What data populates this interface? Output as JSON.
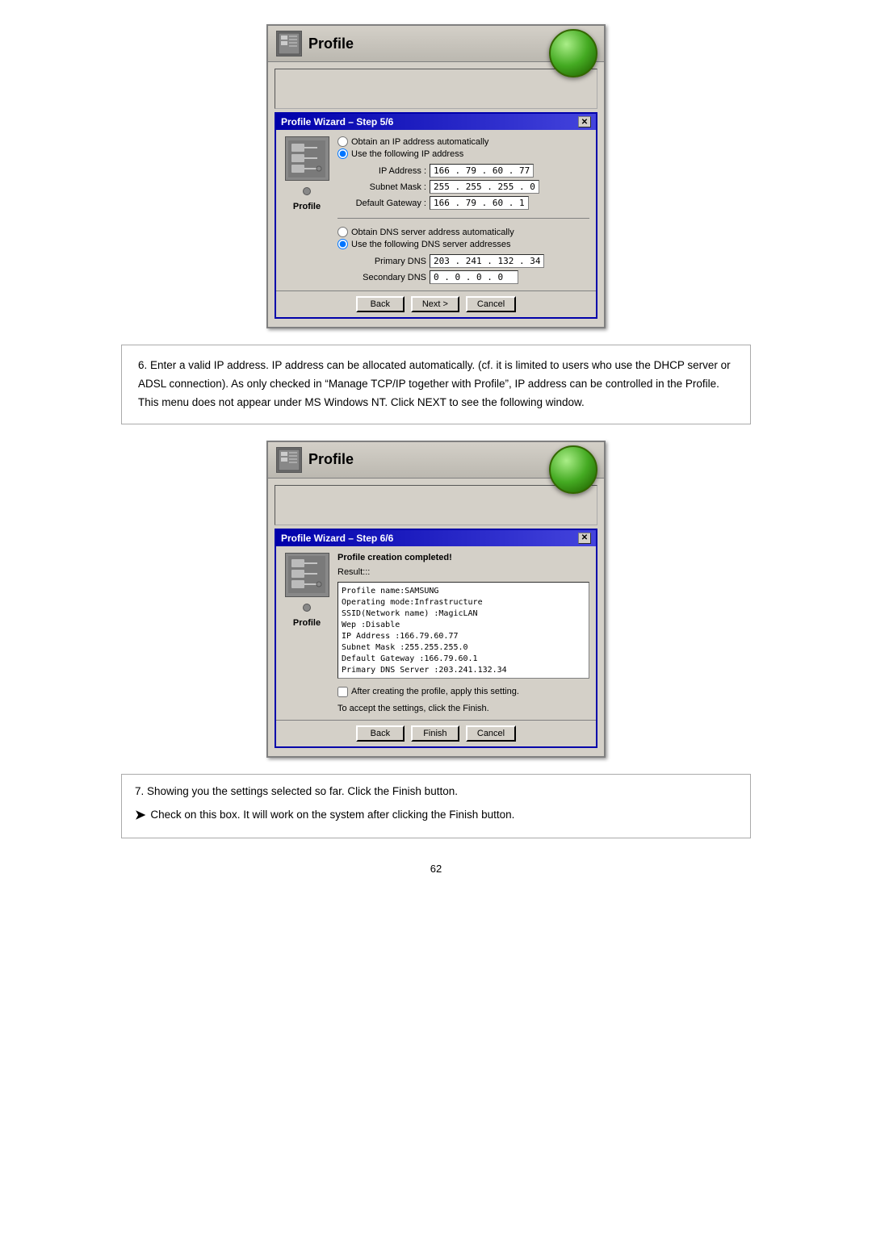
{
  "page": {
    "number": "62"
  },
  "window1": {
    "title": "Profile",
    "wizard_title": "Profile Wizard – Step 5/6",
    "close_btn": "✕",
    "radio1": "Obtain an IP address automatically",
    "radio2": "Use the following IP address",
    "ip_label": "IP Address :",
    "ip_value": "166 . 79 . 60 . 77",
    "subnet_label": "Subnet Mask :",
    "subnet_value": "255 . 255 . 255 . 0",
    "gateway_label": "Default Gateway :",
    "gateway_value": "166 . 79 . 60 . 1",
    "dns_radio1": "Obtain DNS server address automatically",
    "dns_radio2": "Use the following DNS server addresses",
    "primary_label": "Primary DNS",
    "primary_value": "203 . 241 . 132 . 34",
    "secondary_label": "Secondary DNS",
    "secondary_value": "0 . 0 . 0 . 0",
    "back_btn": "Back",
    "next_btn": "Next >",
    "cancel_btn": "Cancel",
    "profile_label": "Profile"
  },
  "info1": {
    "text": "6. Enter a valid IP address. IP address can be allocated automatically. (cf. it is limited to users who use the DHCP server or ADSL connection). As only checked in “Manage TCP/IP together with Profile”, IP address can be controlled in the Profile. This menu does not appear under MS Windows NT. Click NEXT to see the following window."
  },
  "window2": {
    "title": "Profile",
    "wizard_title": "Profile Wizard – Step 6/6",
    "close_btn": "✕",
    "completed_text": "Profile creation completed!",
    "result_label": "Result:::",
    "result_lines": [
      "Profile name:SAMSUNG",
      "Operating mode:Infrastructure",
      "SSID(Network name) :MagicLAN",
      "Wep :Disable",
      "IP Address :166.79.60.77",
      "Subnet Mask :255.255.255.0",
      "Default Gateway :166.79.60.1",
      "Primary DNS Server :203.241.132.34"
    ],
    "apply_label": "After creating the profile, apply this setting.",
    "accept_text": "To accept the settings, click the Finish.",
    "back_btn": "Back",
    "finish_btn": "Finish",
    "cancel_btn": "Cancel",
    "profile_label": "Profile"
  },
  "info2": {
    "step7": "7.  Showing you the settings selected so far.  Click the Finish button.",
    "arrow_text": "Check on this box. It will work on the system after clicking the Finish button."
  }
}
